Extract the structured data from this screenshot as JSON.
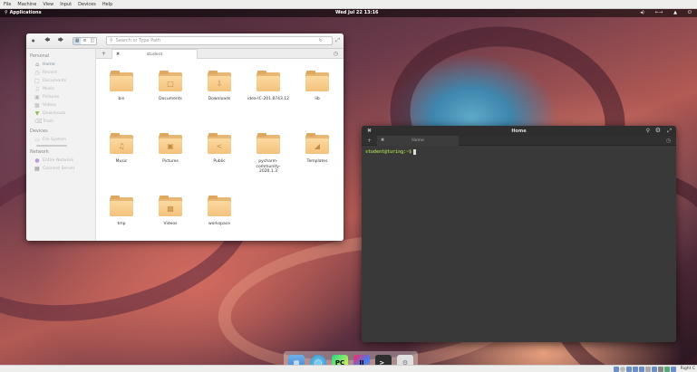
{
  "host_menu": [
    "File",
    "Machine",
    "View",
    "Input",
    "Devices",
    "Help"
  ],
  "top_panel": {
    "applications": "Applications",
    "clock": "Wed Jul 22  13:16"
  },
  "files": {
    "path_placeholder": "Search or Type Path",
    "tab_label": "student",
    "sidebar": {
      "personal_heading": "Personal",
      "personal": [
        "Home",
        "Recent",
        "Documents",
        "Music",
        "Pictures",
        "Videos",
        "Downloads",
        "Trash"
      ],
      "devices_heading": "Devices",
      "devices": [
        "File System"
      ],
      "network_heading": "Network",
      "network": [
        "Entire Network",
        "Connect Server"
      ]
    },
    "items": [
      {
        "name": "bin",
        "icon": "folder-icon"
      },
      {
        "name": "Documents",
        "icon": "document-icon"
      },
      {
        "name": "Downloads",
        "icon": "download-icon"
      },
      {
        "name": "idea-IC-201.8743.12",
        "icon": "folder-icon"
      },
      {
        "name": "lib",
        "icon": "folder-icon"
      },
      {
        "name": "Music",
        "icon": "music-icon"
      },
      {
        "name": "Pictures",
        "icon": "pictures-icon"
      },
      {
        "name": "Public",
        "icon": "share-icon"
      },
      {
        "name": "pycharm-community-2020.1.3",
        "icon": "folder-icon"
      },
      {
        "name": "Templates",
        "icon": "templates-icon"
      },
      {
        "name": "tmp",
        "icon": "folder-icon"
      },
      {
        "name": "Videos",
        "icon": "video-icon"
      },
      {
        "name": "workspace",
        "icon": "folder-icon"
      }
    ]
  },
  "terminal": {
    "title": "Home",
    "tab_label": "Home",
    "prompt": "student@turing:~$"
  },
  "dock": [
    "Files",
    "Browser",
    "PyCharm",
    "IntelliJ IDEA",
    "Terminal",
    "System Settings"
  ],
  "vbox_status": {
    "host_key": "Right C"
  }
}
